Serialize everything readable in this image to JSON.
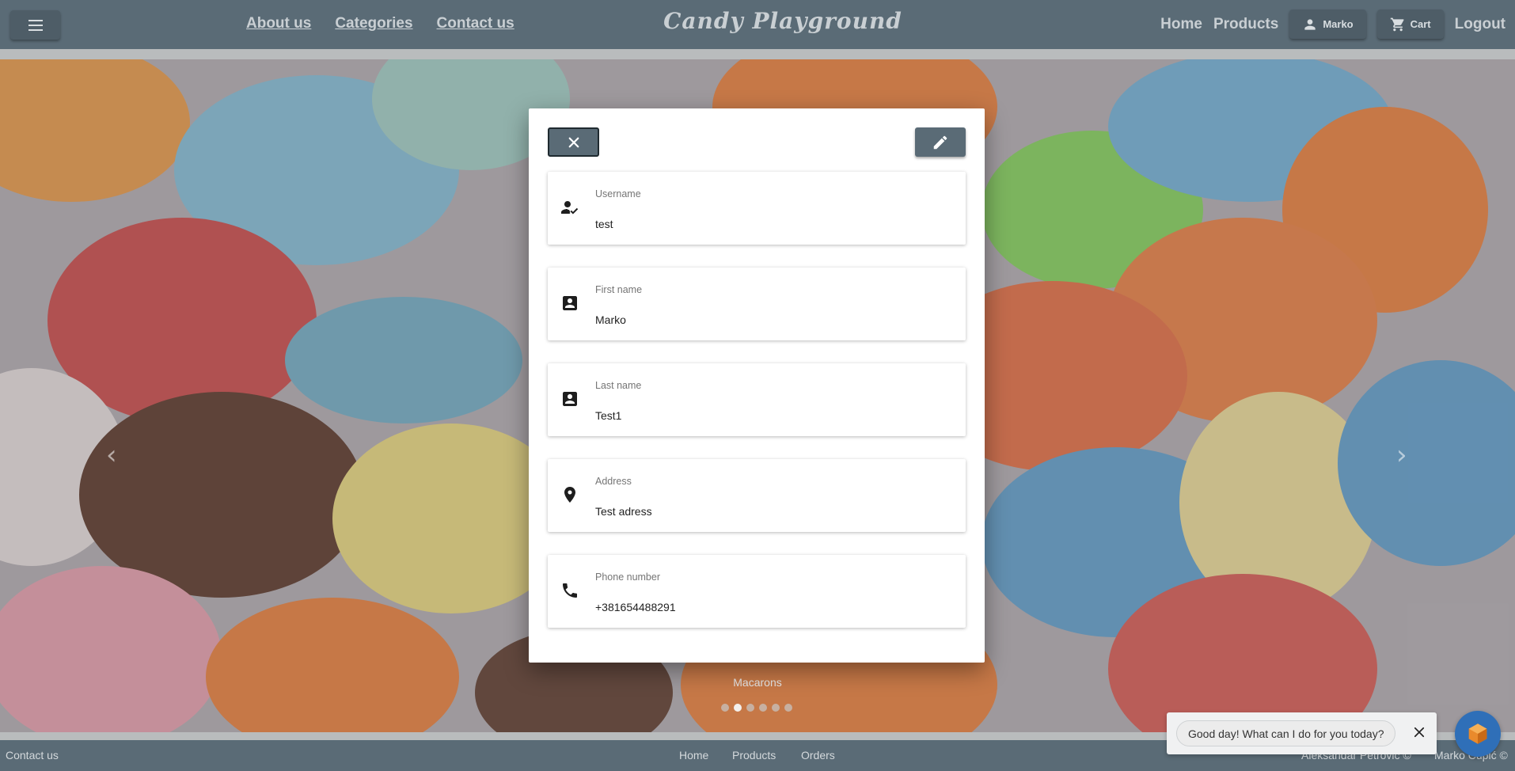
{
  "header": {
    "menu_icon": "hamburger-menu-icon",
    "nav_left": [
      "About us",
      "Categories",
      "Contact us"
    ],
    "brand": "Candy Playground",
    "nav_right": {
      "home": "Home",
      "products": "Products",
      "user_button": "Marko",
      "cart_button": "Cart",
      "logout": "Logout"
    }
  },
  "carousel": {
    "caption": "Macarons",
    "slide_count": 6,
    "active_slide": 2,
    "prev_icon": "chevron-left-icon",
    "next_icon": "chevron-right-icon"
  },
  "modal": {
    "close_icon": "close-icon",
    "edit_icon": "pencil-icon",
    "fields": [
      {
        "label": "Username",
        "value": "test",
        "icon": "person-check-icon"
      },
      {
        "label": "First name",
        "value": "Marko",
        "icon": "contact-card-icon"
      },
      {
        "label": "Last name",
        "value": "Test1",
        "icon": "contact-card-icon"
      },
      {
        "label": "Address",
        "value": "Test adress",
        "icon": "location-pin-icon"
      },
      {
        "label": "Phone number",
        "value": "+381654488291",
        "icon": "phone-icon"
      }
    ]
  },
  "footer": {
    "contact": "Contact us",
    "links": [
      "Home",
      "Products",
      "Orders"
    ],
    "credit_1": "Aleksandar Petrović ©",
    "credit_2": "Marko Čupić ©"
  },
  "chat": {
    "greeting": "Good day! What can I do for you today?",
    "close_icon": "close-icon",
    "avatar_icon": "chatbot-avatar-icon"
  },
  "colors": {
    "header_bg": "#5a6b76",
    "button_bg": "#4e5d67",
    "modal_bg": "#ffffff"
  }
}
